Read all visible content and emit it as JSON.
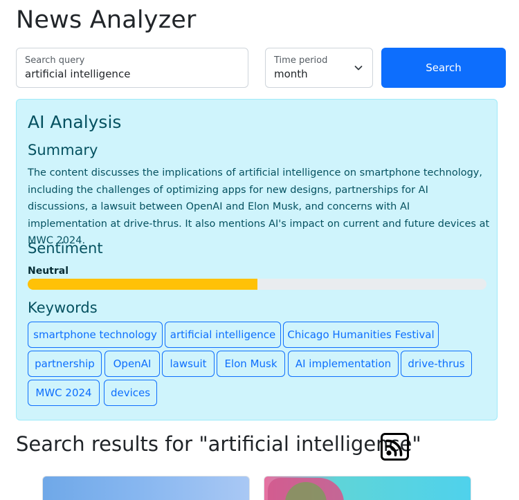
{
  "app": {
    "title": "News Analyzer"
  },
  "search": {
    "label": "Search query",
    "value": "artificial intelligence"
  },
  "period": {
    "label": "Time period",
    "value": "month"
  },
  "search_button": {
    "label": "Search"
  },
  "analysis": {
    "title": "AI Analysis",
    "summary_heading": "Summary",
    "summary_text": "The content discusses the implications of artificial intelligence on smartphone technology, including the challenges of optimizing apps for new designs, partnerships for AI discussions, a lawsuit between OpenAI and Elon Musk, and concerns with AI implementation at drive-thrus. It also mentions AI's impact on current and future devices at MWC 2024.",
    "sentiment_heading": "Sentiment",
    "sentiment_label": "Neutral",
    "sentiment_level": 0.5,
    "sentiment_color": "#ffc107",
    "keywords_heading": "Keywords",
    "keywords": [
      "smartphone technology",
      "artificial intelligence",
      "Chicago Humanities Festival",
      "partnership",
      "OpenAI",
      "lawsuit",
      "Elon Musk",
      "AI implementation",
      "drive-thrus",
      "MWC 2024",
      "devices"
    ]
  },
  "results": {
    "title": "Search results for \"artificial intelligence\"",
    "icon": "rss-icon"
  },
  "colors": {
    "primary": "#0d6efd",
    "info_bg": "#cff4fc",
    "info_text": "#055160"
  }
}
